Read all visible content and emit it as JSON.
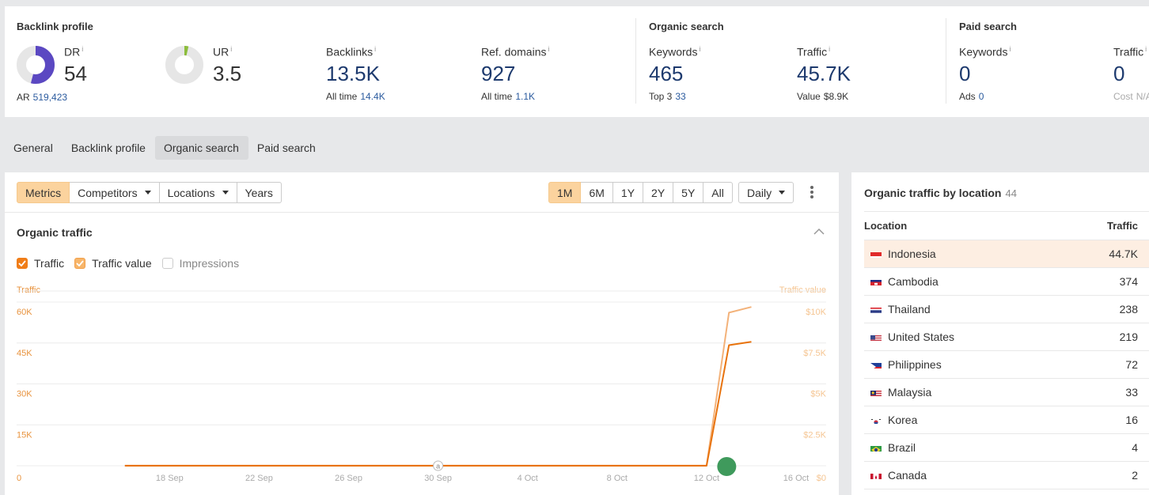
{
  "backlink_profile": {
    "title": "Backlink profile",
    "dr": {
      "label": "DR",
      "value": "54",
      "sub_label": "AR",
      "sub_value": "519,423",
      "gauge_fraction": 0.54,
      "color": "#5b48c2"
    },
    "ur": {
      "label": "UR",
      "value": "3.5",
      "gauge_fraction": 0.035,
      "color": "#8cbd3c"
    },
    "backlinks": {
      "label": "Backlinks",
      "value": "13.5K",
      "sub_label": "All time",
      "sub_value": "14.4K"
    },
    "ref_domains": {
      "label": "Ref. domains",
      "value": "927",
      "sub_label": "All time",
      "sub_value": "1.1K"
    }
  },
  "organic_search": {
    "title": "Organic search",
    "keywords": {
      "label": "Keywords",
      "value": "465",
      "sub_label": "Top 3",
      "sub_value": "33"
    },
    "traffic": {
      "label": "Traffic",
      "value": "45.7K",
      "sub_label": "Value",
      "sub_value": "$8.9K"
    }
  },
  "paid_search": {
    "title": "Paid search",
    "keywords": {
      "label": "Keywords",
      "value": "0",
      "sub_label": "Ads",
      "sub_value": "0"
    },
    "traffic": {
      "label": "Traffic",
      "value": "0",
      "sub_label": "Cost",
      "sub_value": "N/A"
    }
  },
  "info_marker": "i",
  "tabs": [
    {
      "label": "General",
      "active": false
    },
    {
      "label": "Backlink profile",
      "active": false
    },
    {
      "label": "Organic search",
      "active": true
    },
    {
      "label": "Paid search",
      "active": false
    }
  ],
  "toolbar": {
    "view_buttons": [
      {
        "label": "Metrics",
        "active": true,
        "dropdown": false
      },
      {
        "label": "Competitors",
        "active": false,
        "dropdown": true
      },
      {
        "label": "Locations",
        "active": false,
        "dropdown": true
      },
      {
        "label": "Years",
        "active": false,
        "dropdown": false
      }
    ],
    "range_buttons": [
      {
        "label": "1M",
        "active": true
      },
      {
        "label": "6M",
        "active": false
      },
      {
        "label": "1Y",
        "active": false
      },
      {
        "label": "2Y",
        "active": false
      },
      {
        "label": "5Y",
        "active": false
      },
      {
        "label": "All",
        "active": false
      }
    ],
    "interval": "Daily"
  },
  "chart_section": {
    "title": "Organic traffic",
    "checkboxes": [
      {
        "label": "Traffic",
        "checked": true,
        "color": "#f07d18"
      },
      {
        "label": "Traffic value",
        "checked": true,
        "color": "#f7b56a"
      },
      {
        "label": "Impressions",
        "checked": false
      }
    ]
  },
  "chart_data": {
    "type": "line",
    "title": "Organic traffic",
    "ylabel": "Traffic",
    "y2label": "Traffic value",
    "ylim": [
      0,
      60000
    ],
    "y2lim": [
      0,
      10000
    ],
    "y_ticks": [
      "0",
      "15K",
      "30K",
      "45K",
      "60K"
    ],
    "y2_ticks": [
      "$0",
      "$2.5K",
      "$5K",
      "$7.5K",
      "$10K"
    ],
    "x_ticks": [
      "18 Sep",
      "22 Sep",
      "26 Sep",
      "30 Sep",
      "4 Oct",
      "8 Oct",
      "12 Oct",
      "16 Oct"
    ],
    "x_range_days": [
      0,
      33
    ],
    "grid": true,
    "series": [
      {
        "name": "Traffic",
        "axis": "left",
        "color": "#e8720c",
        "points": [
          [
            3,
            300
          ],
          [
            29,
            300
          ],
          [
            30,
            44500
          ],
          [
            31,
            45700
          ]
        ]
      },
      {
        "name": "Traffic value",
        "axis": "right",
        "color": "#f3b27a",
        "points": [
          [
            3,
            60
          ],
          [
            29,
            60
          ],
          [
            30,
            9400
          ],
          [
            31,
            9750
          ]
        ]
      }
    ],
    "annotations": [
      {
        "label": "a",
        "day": 17,
        "type": "note-marker"
      },
      {
        "day": 29.9,
        "type": "update-marker",
        "color": "#3f9a5c"
      }
    ]
  },
  "locations": {
    "title": "Organic traffic by location",
    "count": "44",
    "headers": [
      "Location",
      "Traffic"
    ],
    "rows": [
      {
        "country": "Indonesia",
        "traffic": "44.7K",
        "flag": "id",
        "highlight": true
      },
      {
        "country": "Cambodia",
        "traffic": "374",
        "flag": "kh"
      },
      {
        "country": "Thailand",
        "traffic": "238",
        "flag": "th"
      },
      {
        "country": "United States",
        "traffic": "219",
        "flag": "us"
      },
      {
        "country": "Philippines",
        "traffic": "72",
        "flag": "ph"
      },
      {
        "country": "Malaysia",
        "traffic": "33",
        "flag": "my"
      },
      {
        "country": "Korea",
        "traffic": "16",
        "flag": "kr"
      },
      {
        "country": "Brazil",
        "traffic": "4",
        "flag": "br"
      },
      {
        "country": "Canada",
        "traffic": "2",
        "flag": "ca"
      }
    ]
  }
}
